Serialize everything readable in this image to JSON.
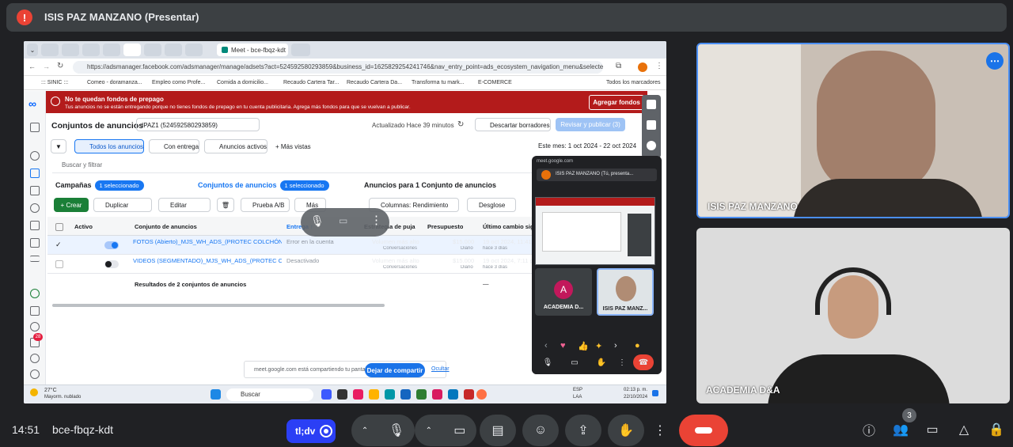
{
  "presenter_bar": {
    "alert": "!",
    "title": "ISIS PAZ MANZANO (Presentar)"
  },
  "shared_screen": {
    "browser": {
      "active_tab": "Meet - bce-fbqz-kdt",
      "url": "https://adsmanager.facebook.com/adsmanager/manage/adsets?act=524592580293859&business_id=1625829254241746&nav_entry_point=ads_ecosystem_navigation_menu&selected_c...",
      "bookmarks": [
        "::: SINIC :::",
        "Comeo - doramanza...",
        "Empleo como Profe...",
        "Comida a domicilio...",
        "Recaudo Cartera Tar...",
        "Recaudo Cartera Da...",
        "Transforma tu mark...",
        "E-COMERCE",
        "Todos los marcadores"
      ]
    },
    "banner": {
      "title": "No te quedan fondos de prepago",
      "text": "Tus anuncios no se están entregando porque no tienes fondos de prepago en tu cuenta publicitaria. Agrega más fondos para que se vuelvan a publicar.",
      "button": "Agregar fondos"
    },
    "header": {
      "title": "Conjuntos de anuncios",
      "account": "IPAZ1 (524592580293859)",
      "updated": "Actualizado Hace 39 minutos",
      "discard": "Descartar borradores",
      "review": "Revisar y publicar (3)"
    },
    "filters": {
      "all": "Todos los anuncios",
      "delivery": "Con entrega",
      "active": "Anuncios activos",
      "more": "+ Más vistas",
      "date": "Este mes: 1 oct 2024 - 22 oct 2024"
    },
    "search_placeholder": "Buscar y filtrar",
    "levels": {
      "campaigns": "Campañas",
      "campaigns_selected": "1 seleccionado",
      "adsets": "Conjuntos de anuncios",
      "adsets_selected": "1 seleccionado",
      "ads": "Anuncios para 1 Conjunto de anuncios"
    },
    "toolbar": {
      "create": "+ Crear",
      "duplicate": "Duplicar",
      "edit": "Editar",
      "ab_test": "Prueba A/B",
      "more": "Más",
      "columns": "Columnas: Rendimiento",
      "breakdown": "Desglose"
    },
    "table": {
      "headers": [
        "Activo",
        "Conjunto de anuncios",
        "Entrega ↑",
        "Estrategia de puja",
        "Presupuesto",
        "Último cambio significativo"
      ],
      "rows": [
        {
          "name": "FOTOS (Abierto)_MJS_WH_ADS_(PROTEC COLCHÓN)",
          "delivery": "Error en la cuenta",
          "bid": "Volumen más alto",
          "bid_sub": "Conversaciones",
          "budget": "$15.000",
          "budget_sub": "Diario",
          "changed": "19 oct 2024, 11:41 am",
          "changed_sub": "hace 3 días"
        },
        {
          "name": "VIDEOS (SEGMENTADO)_MJS_WH_ADS_(PROTEC CO...",
          "delivery": "Desactivado",
          "bid": "Volumen más alto",
          "bid_sub": "Conversaciones",
          "budget": "$15.000",
          "budget_sub": "Diario",
          "changed": "19 oct 2024, 7:11 pm",
          "changed_sub": "hace 3 días"
        }
      ],
      "summary": "Resultados de 2 conjuntos de anuncios",
      "summary_dash": "—"
    },
    "share_notice": {
      "text": "meet.google.com está compartiendo tu pantalla",
      "stop": "Dejar de compartir",
      "hide": "Ocultar"
    },
    "left_badge": "28",
    "taskbar": {
      "weather_temp": "27°C",
      "weather_desc": "Mayorm. nublado",
      "search": "Buscar",
      "lang": "ESP",
      "lang2": "LAA",
      "time": "02:13 p. m.",
      "date": "22/10/2024"
    },
    "pip": {
      "url": "meet.google.com",
      "bar": "ISIS PAZ MANZANO (Tú, presenta...",
      "tile_a_initial": "A",
      "tile_a_name": "ACADEMIA D...",
      "tile_i_name": "ISIS PAZ MANZ..."
    }
  },
  "participants": [
    {
      "name": "ISIS PAZ MANZANO"
    },
    {
      "name": "ACADEMIA D&A"
    }
  ],
  "bottom_bar": {
    "time": "14:51",
    "meeting_code": "bce-fbqz-kdt",
    "caption": "tl;dv",
    "people_count": "3"
  }
}
